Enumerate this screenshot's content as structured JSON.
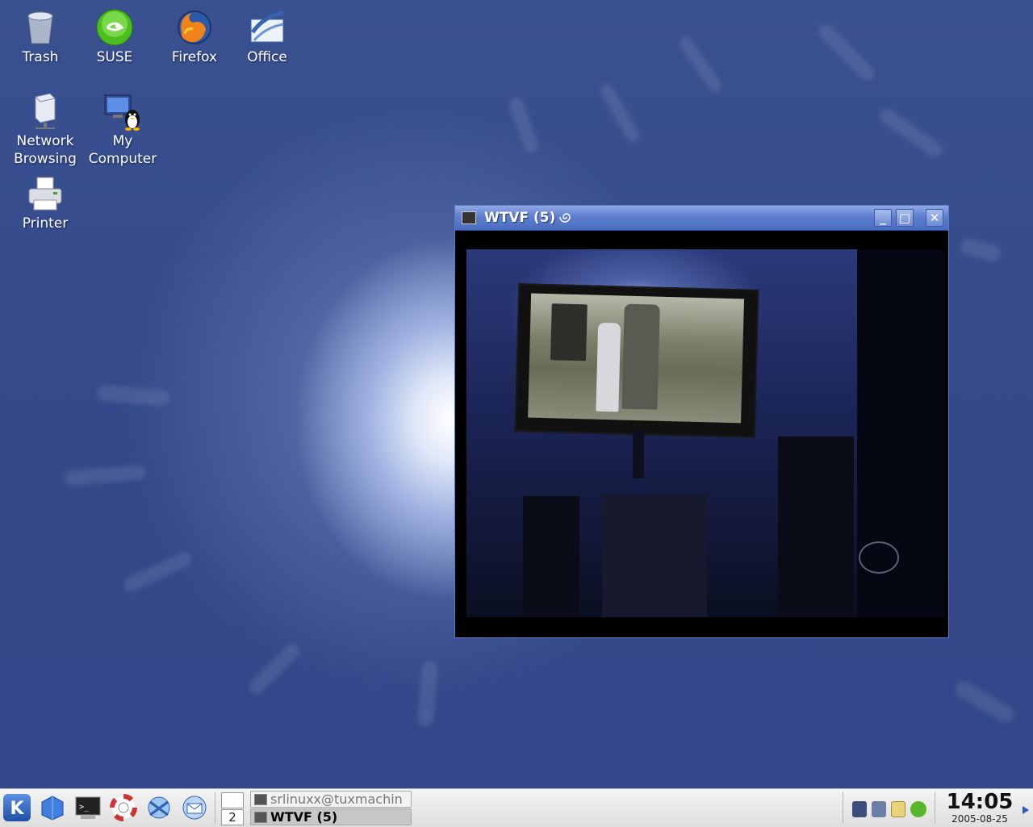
{
  "desktop": {
    "icons": [
      {
        "label": "Trash",
        "icon": "trash-icon"
      },
      {
        "label": "SUSE",
        "icon": "suse-icon"
      },
      {
        "label": "Firefox",
        "icon": "firefox-icon"
      },
      {
        "label": "Office",
        "icon": "office-icon"
      },
      {
        "label": "Network\nBrowsing",
        "icon": "network-icon"
      },
      {
        "label": "My\nComputer",
        "icon": "computer-icon"
      },
      {
        "label": "Printer",
        "icon": "printer-icon"
      }
    ]
  },
  "window": {
    "title": "WTVF (5)",
    "minimize_label": "_",
    "maximize_label": "□",
    "close_label": "✕"
  },
  "taskbar": {
    "pager": {
      "desk1": "",
      "desk2": "2"
    },
    "tasks": [
      {
        "label": "srlinuxx@tuxmachin"
      },
      {
        "label": "WTVF (5)"
      }
    ],
    "clock": {
      "time": "14:05",
      "date": "2005-08-25"
    }
  },
  "colors": {
    "desktop_blue": "#34498a",
    "titlebar_blue": "#5e7fcf",
    "taskbar_gray": "#dedede"
  }
}
